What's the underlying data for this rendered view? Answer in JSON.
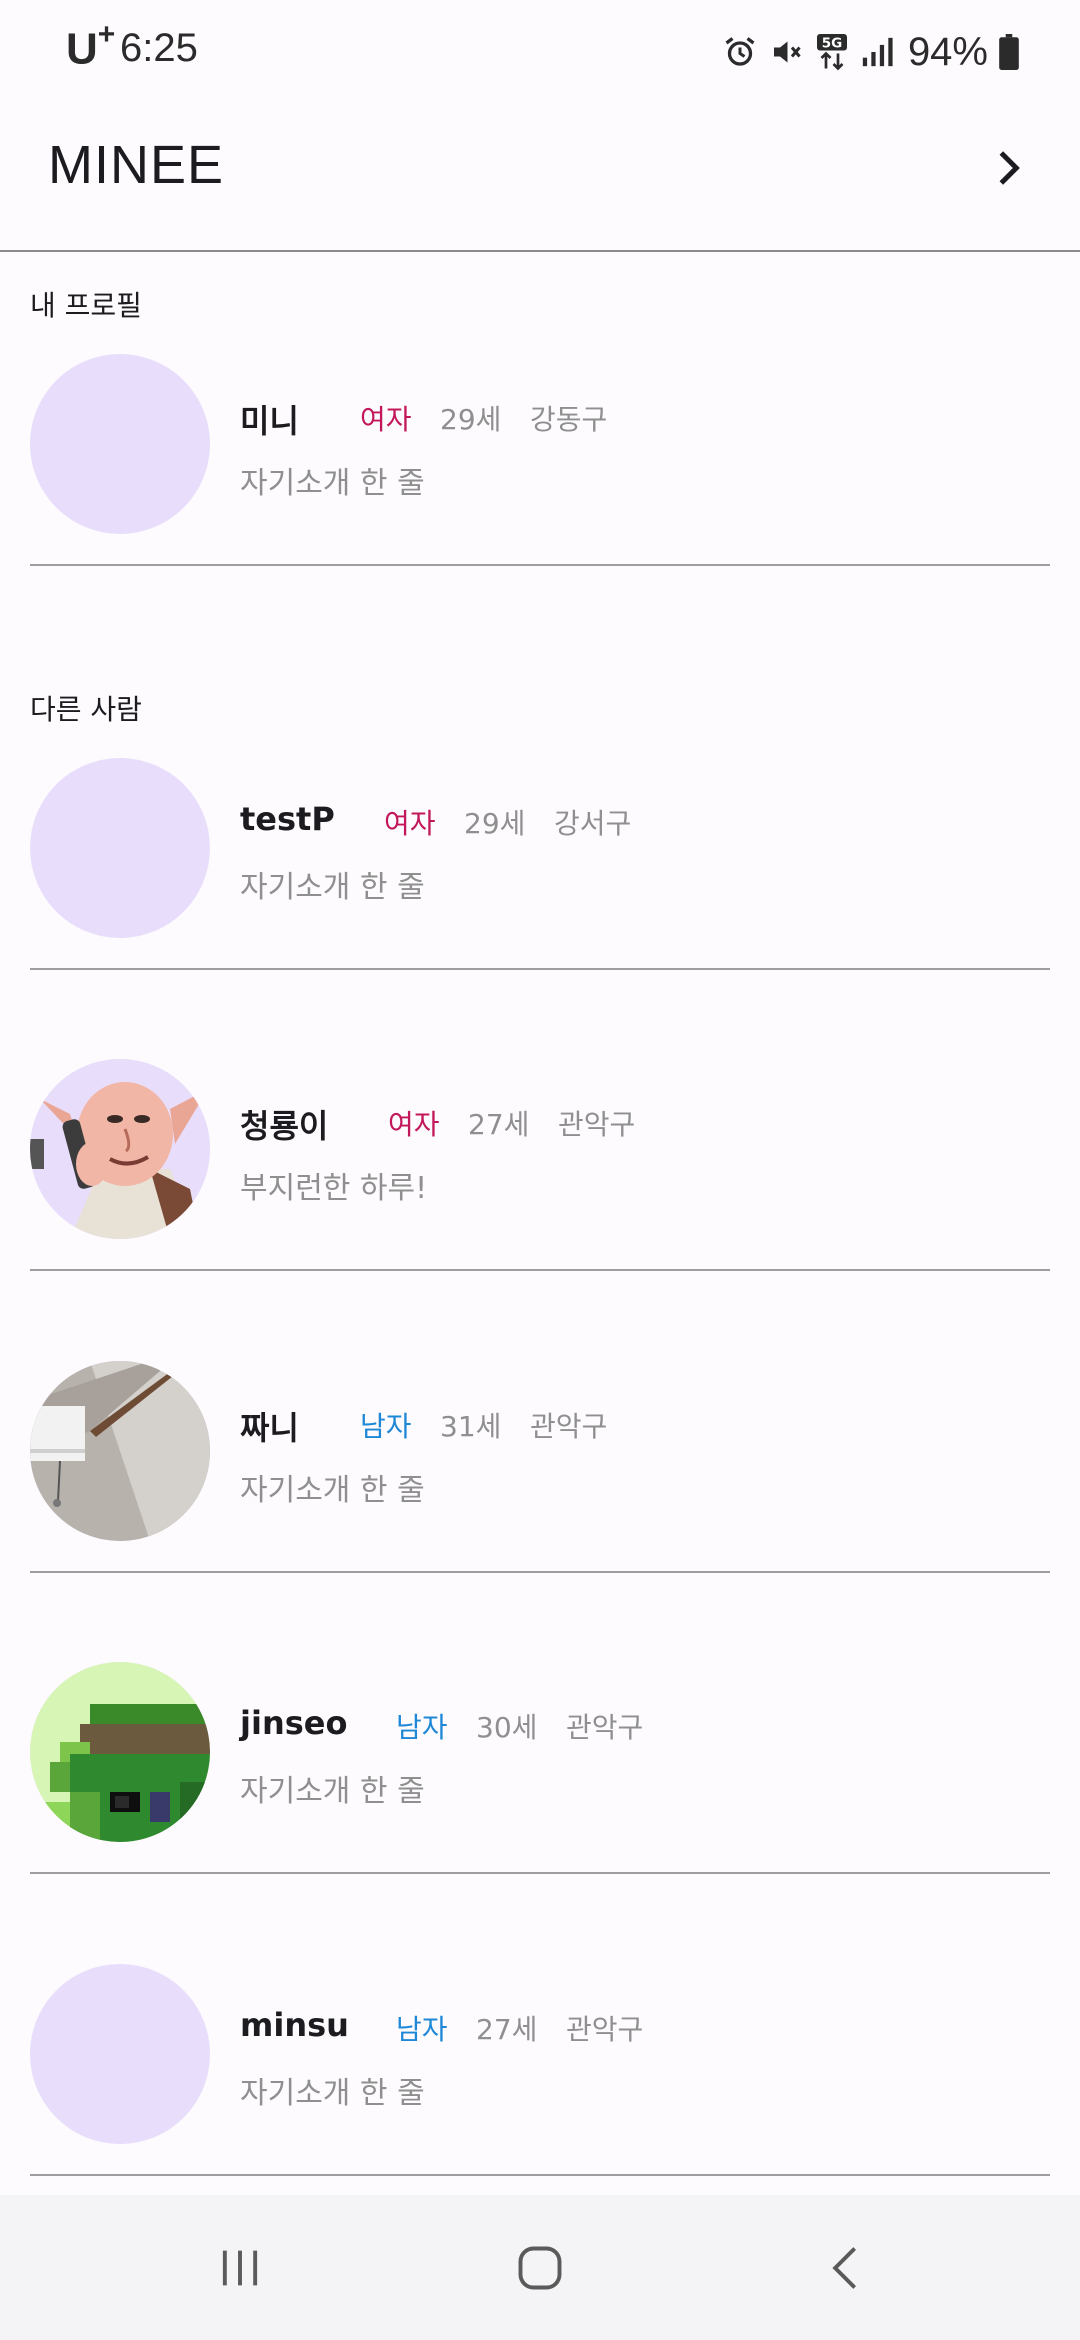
{
  "status_bar": {
    "carrier": "U",
    "carrier_sup": "+",
    "time": "6:25",
    "battery": "94%",
    "icons": [
      "alarm-icon",
      "mute-icon",
      "5g-data-icon",
      "signal-icon",
      "battery-icon"
    ]
  },
  "app_bar": {
    "title": "MINEE",
    "forward_icon": "chevron-right-icon"
  },
  "my_profile": {
    "section_label": "내 프로필",
    "user": {
      "name": "미니",
      "gender": "여자",
      "age": "29세",
      "district": "강동구",
      "intro": "자기소개 한 줄"
    }
  },
  "others": {
    "section_label": "다른 사람",
    "users": [
      {
        "name": "testP",
        "gender": "여자",
        "age": "29세",
        "district": "강서구",
        "intro": "자기소개 한 줄",
        "avatar": "placeholder"
      },
      {
        "name": "청룡이",
        "gender": "여자",
        "age": "27세",
        "district": "관악구",
        "intro": "부지런한 하루!",
        "avatar": "cartoon-elf-photo"
      },
      {
        "name": "짜니",
        "gender": "남자",
        "age": "31세",
        "district": "관악구",
        "intro": "자기소개 한 줄",
        "avatar": "air-conditioner-photo"
      },
      {
        "name": "jinseo",
        "gender": "남자",
        "age": "30세",
        "district": "관악구",
        "intro": "자기소개 한 줄",
        "avatar": "pixel-art-photo"
      },
      {
        "name": "minsu",
        "gender": "남자",
        "age": "27세",
        "district": "관악구",
        "intro": "자기소개 한 줄",
        "avatar": "placeholder"
      }
    ]
  },
  "colors": {
    "female": "#c2185b",
    "male": "#1e88d6",
    "avatar_placeholder": "#e8defb",
    "background": "#fdfbfe"
  }
}
